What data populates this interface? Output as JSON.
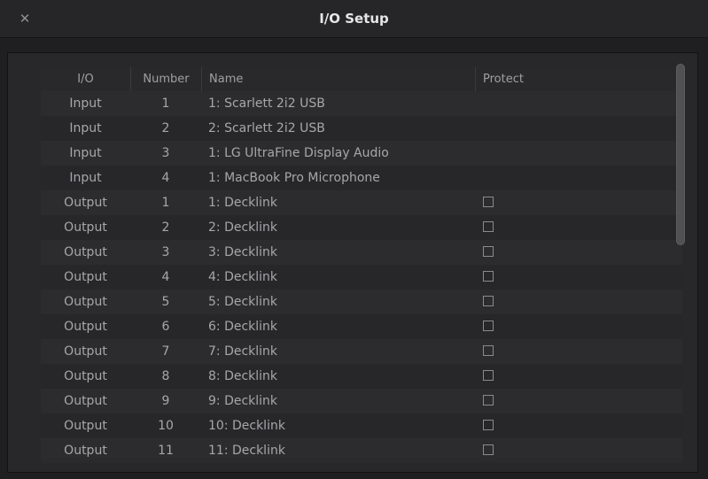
{
  "window": {
    "title": "I/O Setup",
    "close_icon": "close-icon"
  },
  "table": {
    "columns": [
      "I/O",
      "Number",
      "Name",
      "Protect"
    ],
    "rows": [
      {
        "io": "Input",
        "number": "1",
        "name": "1: Scarlett 2i2 USB",
        "protect_checkbox": false
      },
      {
        "io": "Input",
        "number": "2",
        "name": "2: Scarlett 2i2 USB",
        "protect_checkbox": false
      },
      {
        "io": "Input",
        "number": "3",
        "name": "1: LG UltraFine Display Audio",
        "protect_checkbox": false
      },
      {
        "io": "Input",
        "number": "4",
        "name": "1: MacBook Pro Microphone",
        "protect_checkbox": false
      },
      {
        "io": "Output",
        "number": "1",
        "name": "1: Decklink",
        "protect_checkbox": true,
        "protect": false
      },
      {
        "io": "Output",
        "number": "2",
        "name": "2: Decklink",
        "protect_checkbox": true,
        "protect": false
      },
      {
        "io": "Output",
        "number": "3",
        "name": "3: Decklink",
        "protect_checkbox": true,
        "protect": false
      },
      {
        "io": "Output",
        "number": "4",
        "name": "4: Decklink",
        "protect_checkbox": true,
        "protect": false
      },
      {
        "io": "Output",
        "number": "5",
        "name": "5: Decklink",
        "protect_checkbox": true,
        "protect": false
      },
      {
        "io": "Output",
        "number": "6",
        "name": "6: Decklink",
        "protect_checkbox": true,
        "protect": false
      },
      {
        "io": "Output",
        "number": "7",
        "name": "7: Decklink",
        "protect_checkbox": true,
        "protect": false
      },
      {
        "io": "Output",
        "number": "8",
        "name": "8: Decklink",
        "protect_checkbox": true,
        "protect": false
      },
      {
        "io": "Output",
        "number": "9",
        "name": "9: Decklink",
        "protect_checkbox": true,
        "protect": false
      },
      {
        "io": "Output",
        "number": "10",
        "name": "10: Decklink",
        "protect_checkbox": true,
        "protect": false
      },
      {
        "io": "Output",
        "number": "11",
        "name": "11: Decklink",
        "protect_checkbox": true,
        "protect": false
      }
    ]
  },
  "colors": {
    "background": "#1f1f21",
    "title_text": "#e6e6e8",
    "row_text": "#a7a7aa"
  }
}
